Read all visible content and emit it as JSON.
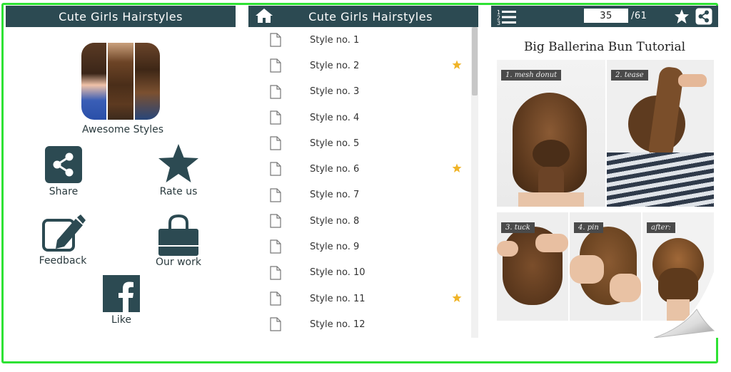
{
  "left_panel": {
    "title": "Cute Girls Hairstyles",
    "hero_label": "Awesome Styles",
    "actions": [
      {
        "label": "Share",
        "icon": "share-icon"
      },
      {
        "label": "Rate us",
        "icon": "star-icon"
      },
      {
        "label": "Feedback",
        "icon": "edit-icon"
      },
      {
        "label": "Our work",
        "icon": "shopping-bag-icon"
      },
      {
        "label": "Like",
        "icon": "facebook-icon"
      }
    ]
  },
  "list_panel": {
    "title": "Cute Girls Hairstyles",
    "home_icon": "home-icon",
    "items": [
      {
        "label": "Style no. 1",
        "starred": false
      },
      {
        "label": "Style no. 2",
        "starred": true
      },
      {
        "label": "Style no. 3",
        "starred": false
      },
      {
        "label": "Style no. 4",
        "starred": false
      },
      {
        "label": "Style no. 5",
        "starred": false
      },
      {
        "label": "Style no. 6",
        "starred": true
      },
      {
        "label": "Style no. 7",
        "starred": false
      },
      {
        "label": "Style no. 8",
        "starred": false
      },
      {
        "label": "Style no. 9",
        "starred": false
      },
      {
        "label": "Style no. 10",
        "starred": false
      },
      {
        "label": "Style no. 11",
        "starred": true
      },
      {
        "label": "Style no. 12",
        "starred": false
      }
    ]
  },
  "viewer_panel": {
    "page": "35",
    "total": "/61",
    "tutorial_title": "Big Ballerina Bun Tutorial",
    "steps": [
      "1. mesh donut",
      "2. tease",
      "3. tuck",
      "4. pin",
      "after:"
    ]
  },
  "colors": {
    "header": "#2c4a52",
    "frame": "#2ee234",
    "star": "#f0b428"
  }
}
